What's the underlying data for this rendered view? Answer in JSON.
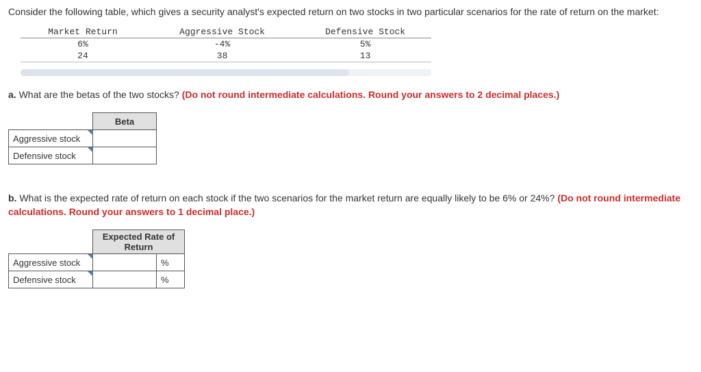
{
  "intro": "Consider the following table, which gives a security analyst's expected return on two stocks in two particular scenarios for the rate of return on the market:",
  "scenario_table": {
    "headers": [
      "Market Return",
      "Aggressive Stock",
      "Defensive Stock"
    ],
    "rows": [
      [
        "6%",
        "-4%",
        "5%"
      ],
      [
        "24",
        "38",
        "13"
      ]
    ]
  },
  "qa": {
    "label": "a.",
    "text": " What are the betas of the two stocks? ",
    "red": "(Do not round intermediate calculations. Round your answers to 2 decimal places.)"
  },
  "beta_table": {
    "header": "Beta",
    "rows": [
      "Aggressive stock",
      "Defensive stock"
    ]
  },
  "qb": {
    "label": "b.",
    "text": " What is the expected rate of return on each stock if the two scenarios for the market return are equally likely to be 6% or 24%? ",
    "red": "(Do not round intermediate calculations. Round your answers to 1 decimal place.)"
  },
  "err_table": {
    "header": "Expected Rate of Return",
    "rows": [
      "Aggressive stock",
      "Defensive stock"
    ],
    "unit": "%"
  }
}
